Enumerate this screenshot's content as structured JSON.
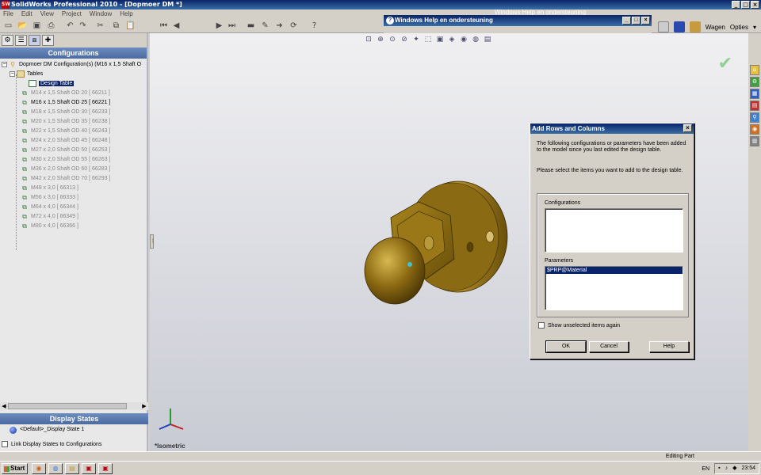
{
  "window": {
    "title": "SolidWorks Professional 2010 - [Dopmoer DM *]",
    "app_icon_label": "SW"
  },
  "menu": [
    "File",
    "Edit",
    "View",
    "Project",
    "Window",
    "Help"
  ],
  "toolbar_right": {
    "search_label": "Wagen",
    "options_label": "Opties"
  },
  "help_window": {
    "title": "Windows Help en ondersteuning",
    "behind_title": "Windows Help en ondersteuning"
  },
  "left_panel": {
    "header": "Configurations",
    "root": "Dopmoer DM Configuration(s)  (M16 x 1,5 Shaft O",
    "tables_label": "Tables",
    "design_table": "Design Table",
    "configurations": [
      {
        "label": "M14 x 1,5 Shaft OD 20 [ 66211 ]",
        "active": false
      },
      {
        "label": "M16 x 1,5 Shaft OD 25 [ 66221 ]",
        "active": true
      },
      {
        "label": "M18 x 1,5 Shaft OD 30 [ 66233 ]",
        "active": false
      },
      {
        "label": "M20 x 1,5 Shaft OD 35 [ 66238 ]",
        "active": false
      },
      {
        "label": "M22 x 1,5 Shaft OD 40 [ 66243 ]",
        "active": false
      },
      {
        "label": "M24 x 2,0 Shaft OD 45 [ 66248 ]",
        "active": false
      },
      {
        "label": "M27 x 2,0 Shaft OD 50 [ 66253 ]",
        "active": false
      },
      {
        "label": "M30 x 2,0 Shaft OD 55 [ 66263 ]",
        "active": false
      },
      {
        "label": "M36 x 2,0 Shaft OD 60 [ 66283 ]",
        "active": false
      },
      {
        "label": "M42 x 2,0 Shaft OD 70 [ 66293 ]",
        "active": false
      },
      {
        "label": "M48 x 3,0 [ 66313 ]",
        "active": false
      },
      {
        "label": "M56 x 3,0 [ 66333 ]",
        "active": false
      },
      {
        "label": "M64 x 4,0 [ 66344 ]",
        "active": false
      },
      {
        "label": "M72 x 4,0 [ 66349 ]",
        "active": false
      },
      {
        "label": "M80 x 4,0 [ 66366 ]",
        "active": false
      }
    ],
    "display_states_header": "Display States",
    "display_state": "<Default>_Display State 1",
    "link_label": "Link Display States to Configurations"
  },
  "viewport": {
    "view_label": "*Isometric"
  },
  "dialog": {
    "title": "Add Rows and Columns",
    "message1": "The following configurations or parameters have been added to the model since you last edited the design table.",
    "message2": "Please select the items you want to add to the design table.",
    "configurations_label": "Configurations",
    "parameters_label": "Parameters",
    "parameters": [
      "$PRP@Material"
    ],
    "show_unselected_label": "Show unselected items again",
    "ok_label": "OK",
    "cancel_label": "Cancel",
    "help_label": "Help"
  },
  "status": {
    "mode": "Editing Part"
  },
  "taskbar": {
    "start_label": "Start",
    "language": "EN",
    "time": "23:54"
  },
  "colors": {
    "titlebar": "#0a246a",
    "part": "#8a6a10",
    "panel_header": "#5a7ab0"
  }
}
